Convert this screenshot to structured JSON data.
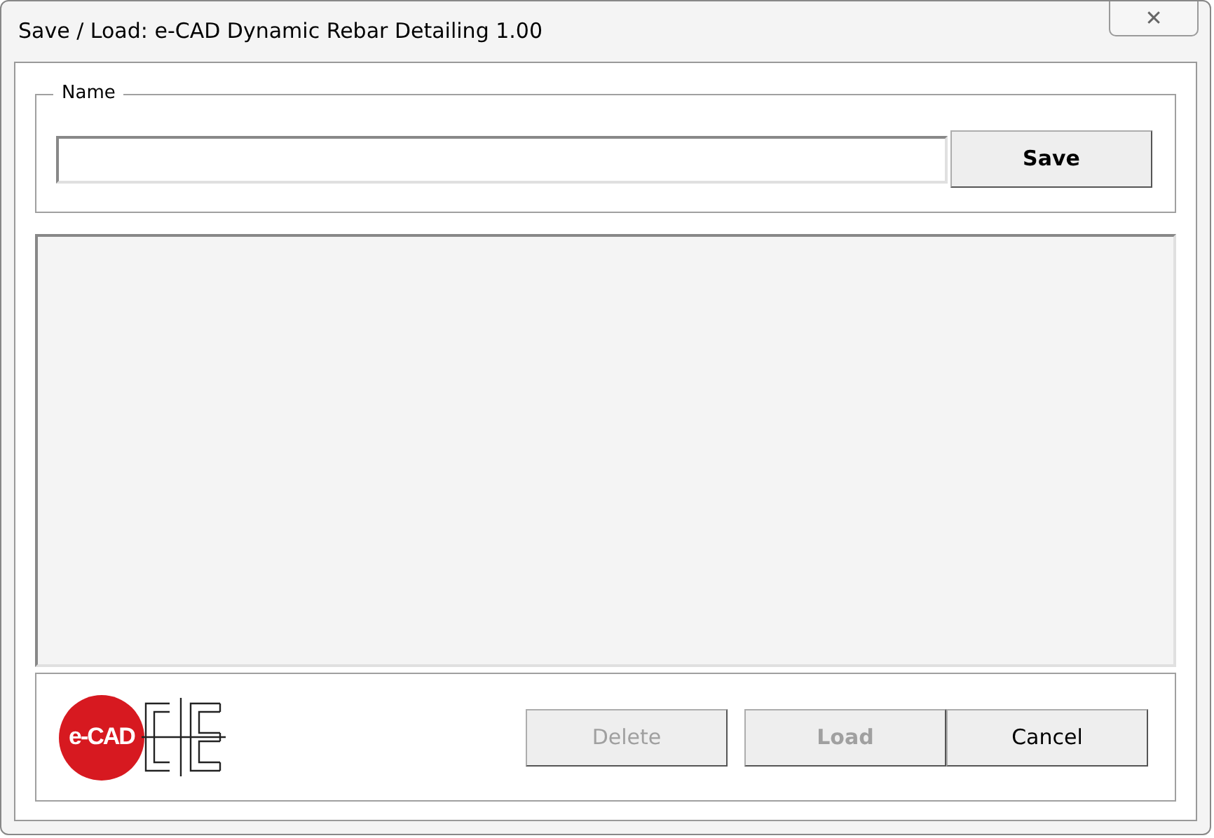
{
  "window": {
    "title": "Save / Load: e-CAD Dynamic Rebar Detailing 1.00",
    "close": "✕"
  },
  "name_group": {
    "label": "Name",
    "save_button": {
      "label": "Save",
      "disabled": false,
      "bold": true
    }
  },
  "logo": {
    "text": "e-CAD"
  },
  "buttons": [
    {
      "label": "Delete",
      "disabled": true,
      "bold": false
    },
    {
      "label": "Load",
      "disabled": true,
      "bold": true
    },
    {
      "label": "Cancel",
      "disabled": false,
      "bold": false
    }
  ]
}
